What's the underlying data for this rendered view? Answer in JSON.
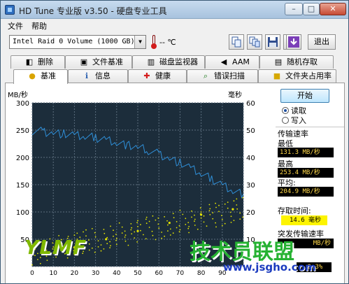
{
  "window": {
    "title": "HD Tune 专业版 v3.50 - 硬盘专业工具"
  },
  "menu": [
    "文件",
    "帮助"
  ],
  "toolbar": {
    "drive": "Intel   Raid 0 Volume (1000 GB)",
    "temperature": "-- ℃",
    "exit_label": "退出",
    "icons": [
      "copy-icon",
      "copy-all-icon",
      "save-icon",
      "options-icon",
      "download-icon"
    ]
  },
  "tabs": {
    "row1": [
      "删除",
      "文件基准",
      "磁盘监视器",
      "AAM",
      "随机存取"
    ],
    "row2": [
      "基准",
      "信息",
      "健康",
      "错误扫描",
      "文件夹占用率"
    ],
    "active": "基准"
  },
  "chart_data": {
    "type": "line",
    "y_left_label": "MB/秒",
    "y_right_label": "毫秒",
    "y_left_ticks": [
      "300",
      "250",
      "200",
      "150",
      "100",
      "50"
    ],
    "y_right_ticks": [
      "60",
      "50",
      "40",
      "30",
      "20",
      "10"
    ],
    "x_ticks": [
      "0",
      "10",
      "20",
      "30",
      "40",
      "50",
      "60",
      "70",
      "80",
      "90"
    ],
    "ylim": [
      0,
      300
    ],
    "y2lim": [
      0,
      60
    ],
    "xlim": [
      0,
      100
    ],
    "series": [
      {
        "name": "传输速率",
        "color": "#2f8fd8",
        "x": [
          0,
          5,
          10,
          15,
          20,
          25,
          30,
          35,
          40,
          45,
          50,
          55,
          60,
          65,
          70,
          75,
          80,
          85,
          90,
          95,
          100
        ],
        "values": [
          249,
          247,
          245,
          243,
          240,
          238,
          236,
          233,
          228,
          222,
          218,
          213,
          206,
          198,
          190,
          180,
          170,
          160,
          150,
          140,
          133
        ]
      },
      {
        "name": "存取时间",
        "color": "#e6e600",
        "x": [
          5,
          20,
          35,
          50,
          65,
          80,
          95
        ],
        "values": [
          5,
          7,
          10,
          13,
          16,
          19,
          21
        ]
      }
    ]
  },
  "controls": {
    "start_label": "开始",
    "read_label": "读取",
    "write_label": "写入",
    "read_selected": true
  },
  "stats": {
    "transfer_rate_label": "传输速率",
    "min_label": "最低",
    "min_value": "131.3 MB/秒",
    "max_label": "最高",
    "max_value": "253.4 MB/秒",
    "avg_label": "平均:",
    "avg_value": "204.9 MB/秒",
    "access_time_label": "存取时间:",
    "access_time_value": "14.6 毫秒",
    "burst_label": "突发传输速率",
    "burst_value": "MB/秒",
    "cpu_value": "9.3%"
  },
  "watermarks": {
    "left": "YLMF",
    "right": "技术员联盟",
    "url": "www.jsgho.com"
  }
}
